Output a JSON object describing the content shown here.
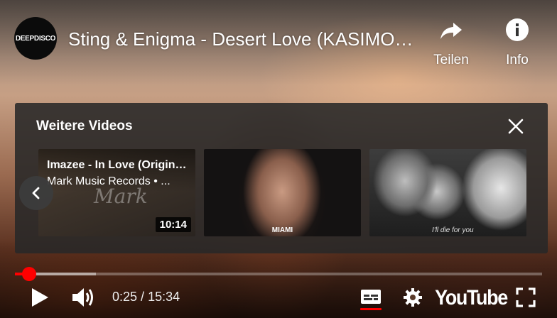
{
  "video": {
    "channel_logo_text": "DEEPDISCO",
    "title": "Sting & Enigma - Desert Love (KASIMOFF Remix)"
  },
  "top_actions": {
    "share": {
      "label": "Teilen",
      "icon": "share-arrow-icon"
    },
    "info": {
      "label": "Info",
      "icon": "info-icon"
    }
  },
  "more_videos": {
    "title": "Weitere Videos",
    "close_icon": "close-icon",
    "prev_icon": "chevron-left-icon",
    "items": [
      {
        "title": "Imazee - In Love (Original Mix)",
        "channel": "Mark Music Records • ...",
        "duration": "10:14",
        "watermark": "Mark"
      },
      {
        "title": "",
        "channel": "",
        "duration": "",
        "caption": "MIAMI"
      },
      {
        "title": "",
        "channel": "",
        "duration": "",
        "caption": "I'll die for you"
      }
    ]
  },
  "player": {
    "progress_fraction": 0.027,
    "buffered_fraction": 0.153,
    "time_current": "0:25",
    "time_total": "15:34",
    "time_separator": " / ",
    "brand": "YouTube",
    "colors": {
      "accent": "#ff0000",
      "panel_bg": "#282828",
      "text": "#ffffff"
    }
  }
}
